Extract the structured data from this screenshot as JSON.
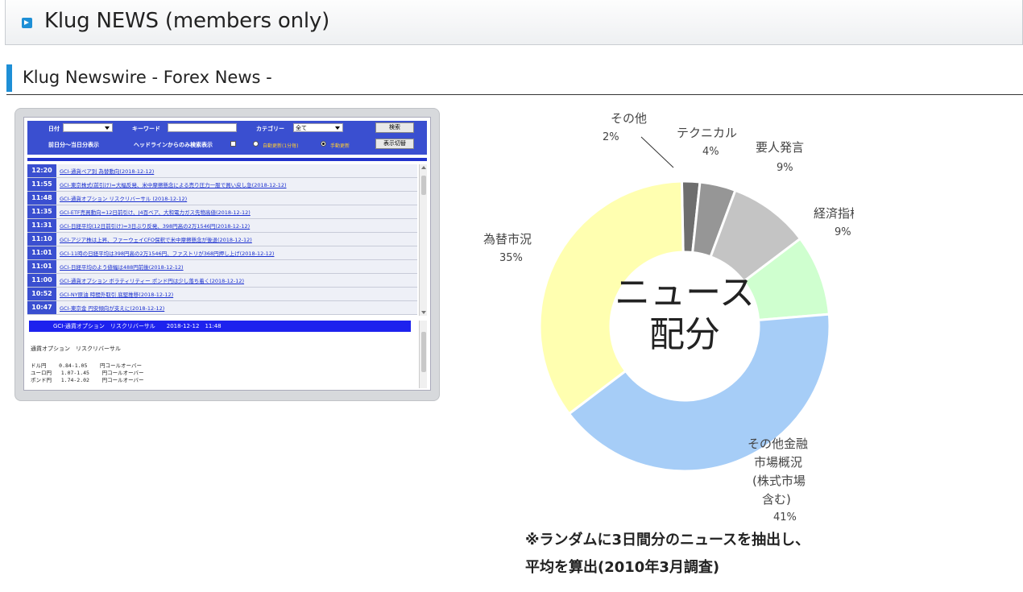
{
  "header": {
    "title": "Klug NEWS (members only)"
  },
  "section": {
    "title": "Klug Newswire - Forex News -"
  },
  "panel": {
    "search": {
      "date_label": "日付",
      "keyword_label": "キーワード",
      "category_label": "カテゴリー",
      "category_value": "全て",
      "search_button": "検索",
      "range_label": "前日分～当日分表示",
      "headline_only_label": "ヘッドラインからのみ検索表示",
      "auto_update_label": "自動更新(1分毎)",
      "manual_update_label": "手動更新",
      "toggle_button": "表示切替"
    },
    "news": [
      {
        "time": "12:20",
        "headline": "GCI-通貨ペア別 為替動向(2018-12-12)"
      },
      {
        "time": "11:55",
        "headline": "GCI-東京株式(前引け)=大幅反発、米中摩擦懸念による売り圧力一服で買い戻し急(2018-12-12)"
      },
      {
        "time": "11:48",
        "headline": "GCI-通貨オプション リスクリバーサル (2018-12-12)"
      },
      {
        "time": "11:35",
        "headline": "GCI-ETF売買動向=12日前引け、J4百ベア、大和電力ガス先物高値(2018-12-12)"
      },
      {
        "time": "11:31",
        "headline": "GCI-日経平均(12日前引け)=3日ぶり反発、398円高の2万1546円(2018-12-12)"
      },
      {
        "time": "11:10",
        "headline": "GCI-アジア株は上昇、ファーウェイCFO保釈で米中摩擦懸念が後退(2018-12-12)"
      },
      {
        "time": "11:01",
        "headline": "GCI-11時の日経平均は398円高の2万1546円、ファストリが368円押し上げ(2018-12-12)"
      },
      {
        "time": "11:01",
        "headline": "GCI-日経平均のよう値幅は488円前後(2018-12-12)"
      },
      {
        "time": "11:00",
        "headline": "GCI-通貨オプション ボラティリティー ポンド円は少し落ち着く(2018-12-12)"
      },
      {
        "time": "10:52",
        "headline": "GCI-NY原油 時間外取引 底堅推移(2018-12-12)"
      },
      {
        "time": "10:47",
        "headline": "GCI-東京金 円安傾向が支えに(2018-12-12)"
      }
    ],
    "detail": {
      "bar": "GCI-通貨オプション　リスクリバーサル　　2018-12-12　11:48",
      "title": "通貨オプション　リスクリバーサル",
      "rates": [
        "ドル円    0.84-1.05    円コールオーバー",
        "ユーロ円   1.07-1.45    円コールオーバー",
        "ポンド円   1.74-2.02    円コールオーバー"
      ]
    }
  },
  "chart_data": {
    "type": "pie",
    "center_label_line1": "ニュース",
    "center_label_line2": "配分",
    "slices": [
      {
        "label": "その他",
        "value": 2,
        "pct": "2%",
        "color": "#6e6e6e"
      },
      {
        "label": "テクニカル",
        "value": 4,
        "pct": "4%",
        "color": "#969696"
      },
      {
        "label": "要人発言",
        "value": 9,
        "pct": "9%",
        "color": "#c4c4c4"
      },
      {
        "label": "経済指標",
        "value": 9,
        "pct": "9%",
        "color": "#cfffcf"
      },
      {
        "label": "その他金融市場概況（株式市場含む）",
        "value": 41,
        "pct": "41%",
        "color": "#a6cdf7"
      },
      {
        "label": "為替市況",
        "value": 35,
        "pct": "35%",
        "color": "#ffffb0"
      }
    ],
    "labels_display": {
      "other": [
        "その他",
        "2%"
      ],
      "technical": [
        "テクニカル",
        "4%"
      ],
      "speeches": [
        "要人発言",
        "9%"
      ],
      "indicators": [
        "経済指標",
        "9%"
      ],
      "markets": [
        "その他金融",
        "市場概況",
        "(株式市場",
        "含む)",
        "41%"
      ],
      "fx": [
        "為替市況",
        "35%"
      ]
    }
  },
  "note": {
    "line1": "※ランダムに3日間分のニュースを抽出し、",
    "line2": "平均を算出(2010年3月調査)"
  }
}
